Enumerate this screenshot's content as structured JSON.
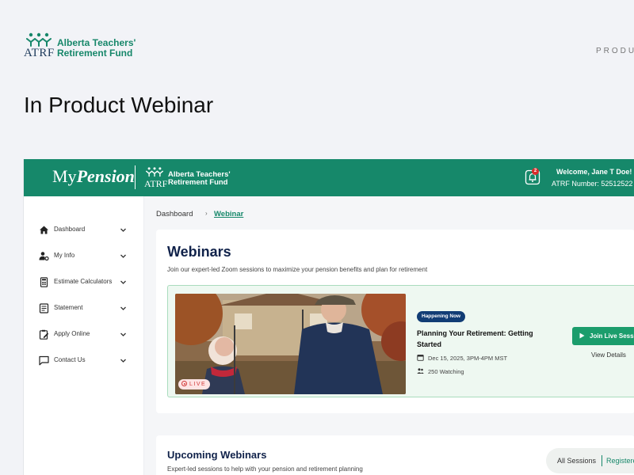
{
  "site": {
    "logo": {
      "letters": "ATRF",
      "org_name": "Alberta Teachers' Retirement Fund"
    },
    "nav_text": "PRODU",
    "page_heading": "In Product Webinar"
  },
  "app": {
    "brand": {
      "part1": "My",
      "part2": "Pension"
    },
    "header_logo": {
      "letters": "ATRF",
      "org_name": "Alberta Teachers' Retirement Fund"
    },
    "notifications": {
      "count": "2",
      "icon": "bell-icon"
    },
    "user": {
      "welcome": "Welcome, Jane T Doe!",
      "member_number": "ATRF Number: 52512522"
    },
    "sidebar": {
      "items": [
        {
          "label": "Dashboard",
          "icon": "home-icon"
        },
        {
          "label": "My Info",
          "icon": "user-settings-icon"
        },
        {
          "label": "Estimate Calculators",
          "icon": "calculator-icon"
        },
        {
          "label": "Statement",
          "icon": "document-icon"
        },
        {
          "label": "Apply Online",
          "icon": "clipboard-edit-icon"
        },
        {
          "label": "Contact Us",
          "icon": "chat-icon"
        }
      ]
    },
    "breadcrumb": {
      "home": "Dashboard",
      "separator": "›",
      "current": "Webinar"
    },
    "webinars": {
      "title": "Webinars",
      "subtitle": "Join our expert-led Zoom sessions to maximize your pension benefits and plan for retirement",
      "live": {
        "tag": "LIVE",
        "status": "Happening Now",
        "title": "Planning Your Retirement: Getting Started",
        "datetime": "Dec 15, 2025, 3PM-4PM MST",
        "watching": "250 Watching",
        "join_label": "Join Live Session",
        "details_label": "View Details"
      }
    },
    "upcoming": {
      "title": "Upcoming Webinars",
      "subtitle": "Expert-led sessions to help with your pension and retirement planning",
      "filters": {
        "all": "All Sessions",
        "registered": "Registered"
      }
    },
    "colors": {
      "brand_green": "#16886a",
      "button_green": "#1b9d6c",
      "navy": "#10224a",
      "badge_blue": "#113d75"
    }
  }
}
